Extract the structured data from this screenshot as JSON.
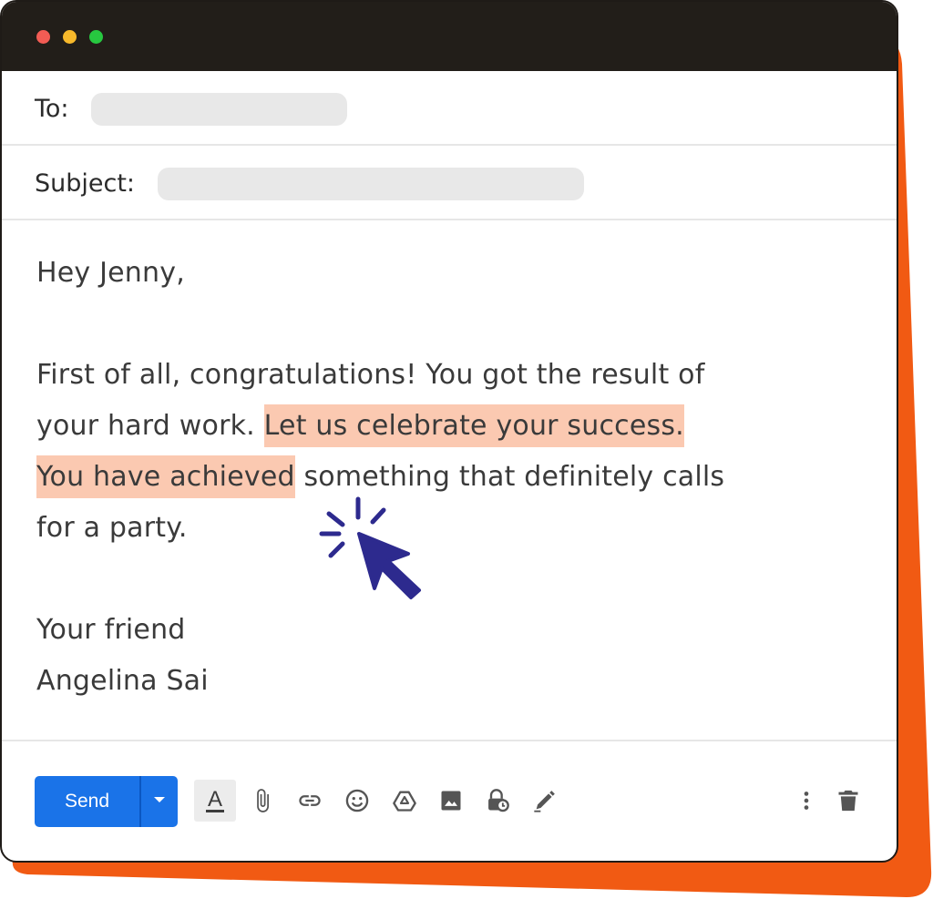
{
  "compose": {
    "to_label": "To:",
    "subject_label": "Subject:",
    "body": {
      "greeting": "Hey Jenny,",
      "line1": "First of all, congratulations! You got the result of",
      "line2_plain": "your hard work. ",
      "line2_highlight": "Let us celebrate your success.",
      "line3_highlight": "You have achieved",
      "line3_plain": " something that definitely calls",
      "line4": "for a party.",
      "signoff": "Your friend",
      "signature": "Angelina Sai"
    },
    "send_label": "Send",
    "format_label": "A"
  },
  "colors": {
    "accent": "#1a73e8",
    "highlight": "#fbc9b1",
    "backing": "#f15a13",
    "titlebar": "#221e19",
    "cursor": "#2d2a8e"
  },
  "icons": [
    "send-dropdown-icon",
    "format-text-icon",
    "attach-icon",
    "link-icon",
    "emoji-icon",
    "drive-icon",
    "image-icon",
    "confidential-icon",
    "signature-icon",
    "more-options-icon",
    "delete-icon",
    "cursor-click-icon"
  ]
}
